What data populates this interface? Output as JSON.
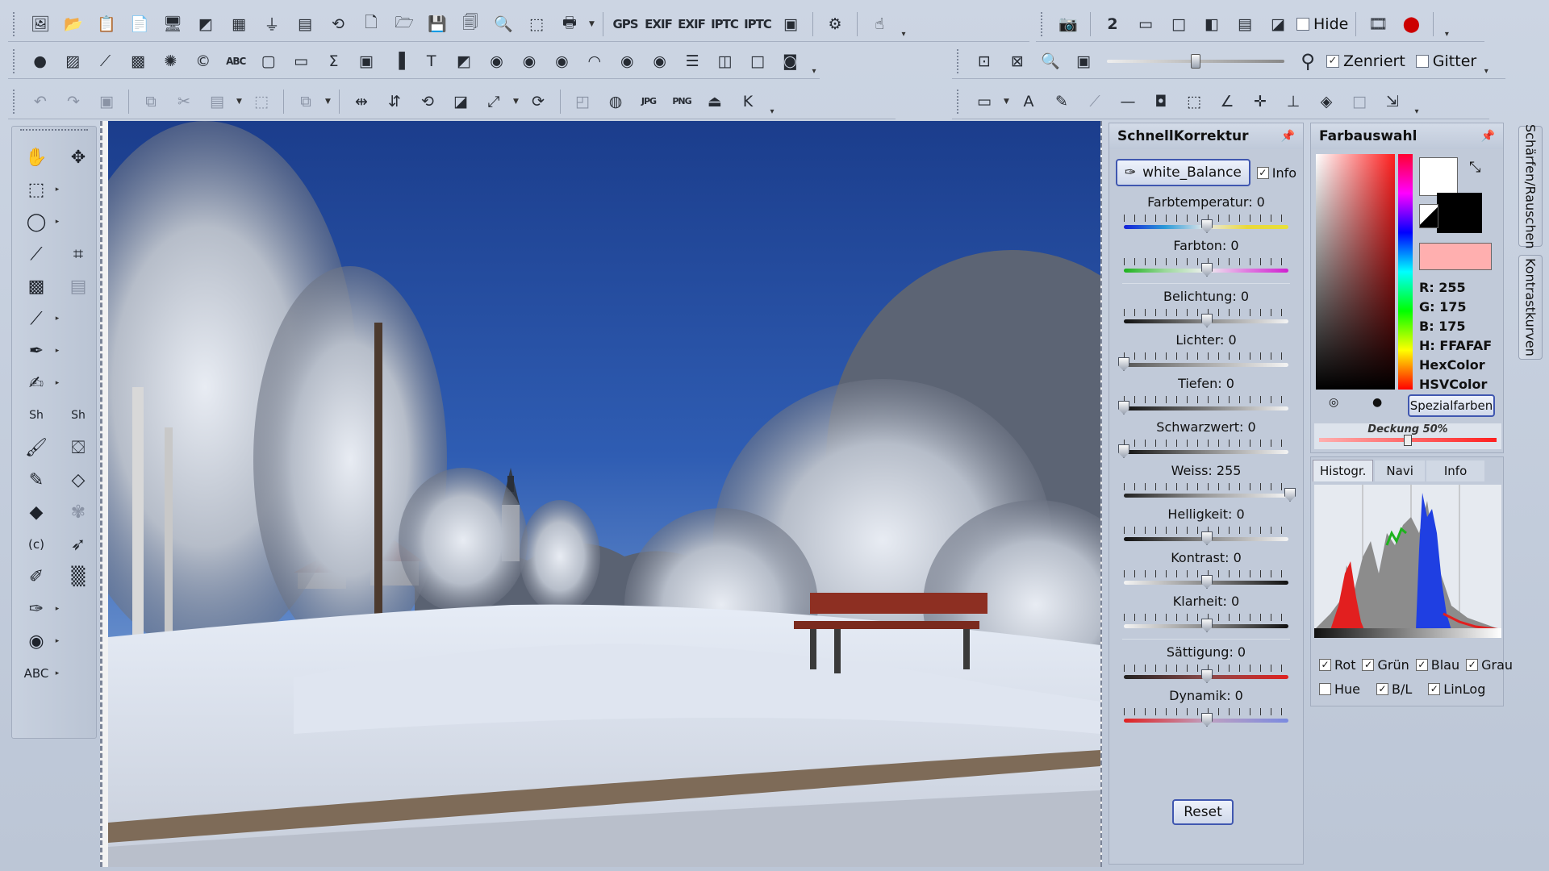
{
  "toolbar_row1": {
    "icons": [
      "image-icon",
      "open-icon",
      "scan-icon",
      "clipboard-icon",
      "screen-icon",
      "film-icon",
      "grid-icon",
      "funnel-icon",
      "filmstrip-icon",
      "batch-icon",
      "new-icon",
      "folder-icon",
      "save-icon",
      "save-as-icon",
      "search-icon",
      "crop-frame-icon",
      "print-icon"
    ],
    "meta_labels": [
      "GPS",
      "EXIF",
      "EXIF",
      "IPTC",
      "IPTC"
    ],
    "hide_label": "Hide",
    "page_number": "2"
  },
  "toolbar_row2": {
    "zenriert_label": "Zenriert",
    "gitter_label": "Gitter",
    "zoom_level": 0.5
  },
  "schnellkorrektur": {
    "title": "SchnellKorrektur",
    "preset_label": "white_Balance",
    "info_label": "Info",
    "sliders": [
      {
        "label": "Farbtemperatur: 0",
        "value": 0.5,
        "gradient": "linear-gradient(90deg,#1420d8,#2b9ad8,#e9e9e9,#e9d83a,#e8e03a)"
      },
      {
        "label": "Farbton: 0",
        "value": 0.5,
        "gradient": "linear-gradient(90deg,#1cb21c,#9ad89a,#f0f0f0,#e07ae0,#d020d0)"
      },
      {
        "label": "Belichtung: 0",
        "value": 0.5,
        "gradient": "linear-gradient(90deg,#111,#888,#f4f4f4)"
      },
      {
        "label": "Lichter: 0",
        "value": 0.0,
        "gradient": "linear-gradient(90deg,#555,#aaa,#f4f4f4)"
      },
      {
        "label": "Tiefen: 0",
        "value": 0.0,
        "gradient": "linear-gradient(90deg,#111,#777,#f4f4f4)"
      },
      {
        "label": "Schwarzwert: 0",
        "value": 0.0,
        "gradient": "linear-gradient(90deg,#111,#888,#f4f4f4)"
      },
      {
        "label": "Weiss: 255",
        "value": 1.0,
        "gradient": "linear-gradient(90deg,#222,#999,#f4f4f4)"
      },
      {
        "label": "Helligkeit: 0",
        "value": 0.5,
        "gradient": "linear-gradient(90deg,#111,#888,#f4f4f4)"
      },
      {
        "label": "Kontrast: 0",
        "value": 0.5,
        "gradient": "linear-gradient(90deg,#f4f4f4,#888,#111)"
      },
      {
        "label": "Klarheit: 0",
        "value": 0.5,
        "gradient": "linear-gradient(90deg,#f4f4f4,#888,#111)"
      },
      {
        "label": "Sättigung: 0",
        "value": 0.5,
        "gradient": "linear-gradient(90deg,#222,#8a4a4a,#e02020)"
      },
      {
        "label": "Dynamik: 0",
        "value": 0.5,
        "gradient": "linear-gradient(90deg,#e02020,#c0a0c0,#7a8ae0)"
      }
    ],
    "reset_label": "Reset"
  },
  "farbauswahl": {
    "title": "Farbauswahl",
    "r": "R: 255",
    "g": "G: 175",
    "b": "B: 175",
    "h": "H: FFAFAF",
    "hexcolor": "HexColor",
    "hsvcolor": "HSVColor",
    "spezialfarben": "Spezialfarben",
    "deckung": "Deckung 50%",
    "deckung_value": 0.5,
    "selected_color": "#ffafaf"
  },
  "histogram": {
    "tabs": [
      "Histogr.",
      "Navi",
      "Info"
    ],
    "checks_row1": [
      {
        "label": "Rot",
        "checked": true
      },
      {
        "label": "Grün",
        "checked": true
      },
      {
        "label": "Blau",
        "checked": true
      },
      {
        "label": "Grau",
        "checked": true
      }
    ],
    "checks_row2": [
      {
        "label": "Hue",
        "checked": false
      },
      {
        "label": "B/L",
        "checked": true
      },
      {
        "label": "LinLog",
        "checked": true
      }
    ]
  },
  "side_tabs": [
    "Schärfen/Rauschen",
    "Kontrastkurven"
  ]
}
